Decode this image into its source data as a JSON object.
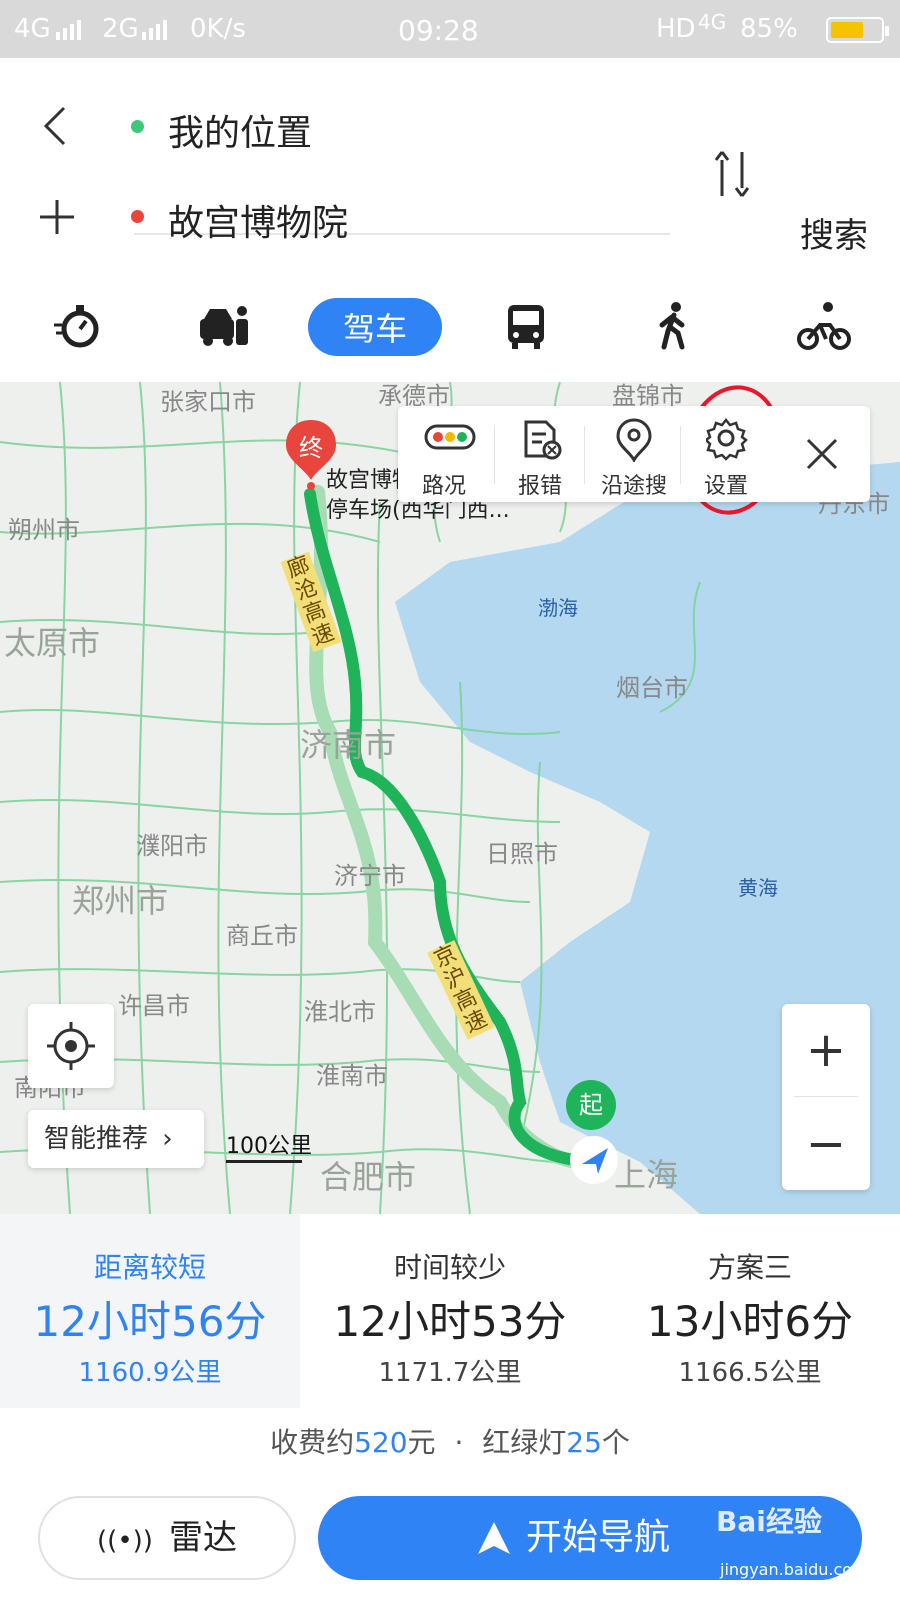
{
  "status_bar": {
    "network_1": "4G",
    "network_2": "2G",
    "speed": "0K/s",
    "time": "09:28",
    "hd": "HD",
    "network_3": "4G",
    "battery": "85%",
    "battery_level": 0.85
  },
  "header": {
    "origin": "我的位置",
    "destination": "故宫博物院",
    "search_label": "搜索",
    "origin_dot_color": "#3cc77b",
    "destination_dot_color": "#e8453c"
  },
  "modes": {
    "items": [
      "timer-icon",
      "carpool-icon",
      "驾车",
      "bus-icon",
      "walk-icon",
      "bike-icon"
    ],
    "active_label": "驾车",
    "accent": "#2f83f4"
  },
  "map": {
    "labels": {
      "zhangjiakou": "张家口市",
      "chengde": "承德市",
      "panjin": "盘锦市",
      "dandong": "丹东市",
      "shuozhou": "朔州市",
      "taiyuan": "太原市",
      "bohai": "渤海",
      "yantai": "烟台市",
      "jinan": "济南市",
      "puyang": "濮阳市",
      "rizhao": "日照市",
      "jining": "济宁市",
      "zhengzhou": "郑州市",
      "huanghai": "黄海",
      "shangqiu": "商丘市",
      "xuchang": "许昌市",
      "huaibei": "淮北市",
      "huainan": "淮南市",
      "nanyang": "南阳市",
      "hefei": "合肥市",
      "shanghai": "上海"
    },
    "end_marker": "终",
    "start_marker": "起",
    "dest_label_1": "故宫博物院",
    "dest_label_2": "停车场(西华门西...",
    "road_1": "廊沧高速",
    "road_2": "京沪高速",
    "route_color": "#1fb45a",
    "alt_route_color": "#a8dcb5",
    "toolbar": {
      "traffic": "路况",
      "report": "报错",
      "along_search": "沿途搜",
      "settings": "设置"
    },
    "smart_recommend": "智能推荐",
    "scale": "100公里"
  },
  "routes": [
    {
      "tag": "距离较短",
      "time": "12小时56分",
      "distance": "1160.9公里",
      "selected": true
    },
    {
      "tag": "时间较少",
      "time": "12小时53分",
      "distance": "1171.7公里",
      "selected": false
    },
    {
      "tag": "方案三",
      "time": "13小时6分",
      "distance": "1166.5公里",
      "selected": false
    }
  ],
  "info": {
    "toll_prefix": "收费约",
    "toll_amount": "520",
    "toll_unit": "元",
    "separator": "·",
    "lights_prefix": "红绿灯",
    "lights_count": "25",
    "lights_unit": "个"
  },
  "actions": {
    "radar": "雷达",
    "start_nav": "开始导航"
  },
  "watermark": {
    "brand": "Bai经验",
    "url": "jingyan.baidu.com"
  }
}
